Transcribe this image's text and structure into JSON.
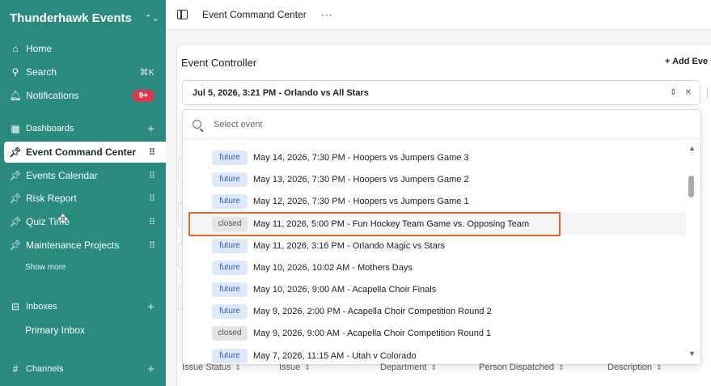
{
  "workspace": {
    "name": "Thunderhawk Events"
  },
  "sidebar": {
    "home": "Home",
    "search": "Search",
    "search_shortcut": "⌘K",
    "notifications": "Notifications",
    "notifications_badge": "9+",
    "dashboards": "Dashboards",
    "pinned": [
      {
        "label": "Event Command Center",
        "active": true
      },
      {
        "label": "Events Calendar"
      },
      {
        "label": "Risk Report"
      },
      {
        "label": "Quiz Time"
      },
      {
        "label": "Maintenance Projects"
      }
    ],
    "show_more": "Show more",
    "inboxes": "Inboxes",
    "primary_inbox": "Primary Inbox",
    "channels": "Channels"
  },
  "topbar": {
    "title": "Event Command Center",
    "more": "···"
  },
  "controller": {
    "title": "Event Controller",
    "add_event": "+ Add Eve",
    "selected": "Jul 5, 2026, 3:21 PM - Orlando vs All Stars"
  },
  "dropdown": {
    "placeholder": "Select event",
    "items": [
      {
        "status": "future",
        "label": "May 14, 2026, 7:30 PM - Hoopers vs Jumpers Game 3"
      },
      {
        "status": "future",
        "label": "May 13, 2026, 7:30 PM - Hoopers vs Jumpers Game 2"
      },
      {
        "status": "future",
        "label": "May 12, 2026, 7:30 PM - Hoopers vs Jumpers Game 1"
      },
      {
        "status": "closed",
        "label": "May 11, 2026, 5:00 PM - Fun Hockey Team Game vs. Opposing Team"
      },
      {
        "status": "future",
        "label": "May 11, 2026, 3:16 PM - Orlando Magic vs Stars"
      },
      {
        "status": "future",
        "label": "May 10, 2026, 10:02 AM - Mothers Days"
      },
      {
        "status": "future",
        "label": "May 10, 2026, 9:00 AM - Acapella Choir Finals"
      },
      {
        "status": "future",
        "label": "May 9, 2026, 2:00 PM - Acapella Choir Competition Round 2"
      },
      {
        "status": "closed",
        "label": "May 9, 2026, 9:00 AM - Acapella Choir Competition Round 1"
      },
      {
        "status": "future",
        "label": "May 7, 2026, 11:15 AM - Utah v Colorado"
      }
    ]
  },
  "table": {
    "headers": [
      "Issue Status",
      "Issue",
      "Department",
      "Person Dispatched",
      "Description"
    ]
  },
  "colors": {
    "sidebar": "#2a8a7f",
    "highlight": "#e36a2e",
    "badge": "#e0374a"
  }
}
